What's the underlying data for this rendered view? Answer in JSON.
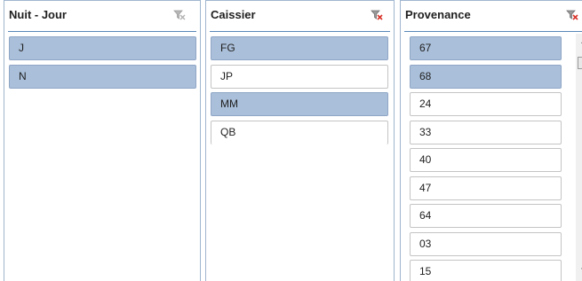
{
  "slicers": [
    {
      "title": "Nuit - Jour",
      "filter_icon": "clear-filter-icon-disabled",
      "items": [
        {
          "label": "J",
          "selected": true
        },
        {
          "label": "N",
          "selected": true
        }
      ]
    },
    {
      "title": "Caissier",
      "filter_icon": "clear-filter-icon-active",
      "items": [
        {
          "label": "FG",
          "selected": true
        },
        {
          "label": "JP",
          "selected": false
        },
        {
          "label": "MM",
          "selected": true
        },
        {
          "label": "QB",
          "selected": false
        }
      ]
    },
    {
      "title": "Provenance",
      "filter_icon": "clear-filter-icon-active",
      "items": [
        {
          "label": "67",
          "selected": true
        },
        {
          "label": "68",
          "selected": true
        },
        {
          "label": "24",
          "selected": false
        },
        {
          "label": "33",
          "selected": false
        },
        {
          "label": "40",
          "selected": false
        },
        {
          "label": "47",
          "selected": false
        },
        {
          "label": "64",
          "selected": false
        },
        {
          "label": "03",
          "selected": false
        },
        {
          "label": "15",
          "selected": false
        }
      ],
      "scrollbar": {
        "up_icon": "scroll-up-arrow-icon",
        "down_icon": "scroll-down-arrow-icon"
      }
    }
  ],
  "colors": {
    "selected_item_bg": "#aabfd9",
    "header_separator": "#5a87b7",
    "filter_funnel": "#8a8a8a",
    "filter_clear_x": "#d9342b"
  }
}
